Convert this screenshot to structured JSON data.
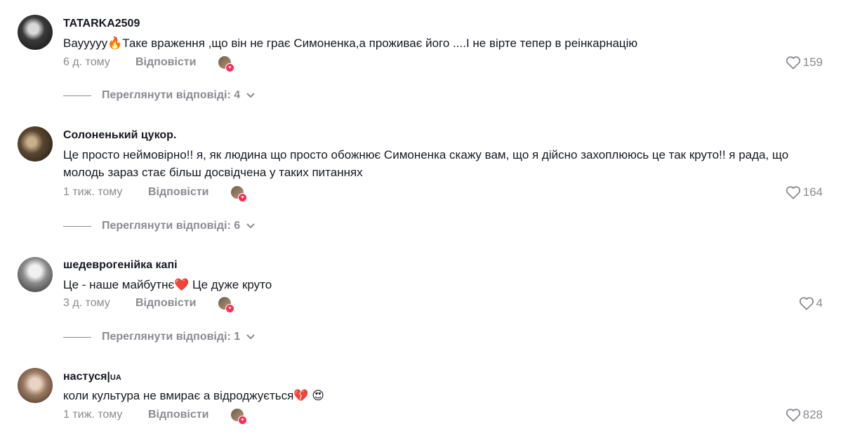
{
  "comments": [
    {
      "username": "TATARKA2509",
      "username_tag": "",
      "text": "Вауууyy🔥Таке враження ,що він не грає Симоненка,а проживає його ....І не вірте тепер в реінкарнацію",
      "time": "6 д. тому",
      "reply_label": "Відповісти",
      "likes": "159",
      "view_replies": "Переглянути відповіді: 4"
    },
    {
      "username": "Солоненький цукор.",
      "username_tag": "",
      "text": "Це просто неймовірно!! я, як людина що просто обожнює Симоненка скажу вам, що я дійсно захоплююсь це так круто!! я рада, що молодь зараз стає більш досвідчена у таких питаннях",
      "time": "1 тиж. тому",
      "reply_label": "Відповісти",
      "likes": "164",
      "view_replies": "Переглянути відповіді: 6"
    },
    {
      "username": "шедеврогенійка капі",
      "username_tag": "",
      "text": "Це - наше майбутнє❤️ Це дуже круто",
      "time": "3 д. тому",
      "reply_label": "Відповісти",
      "likes": "4",
      "view_replies": "Переглянути відповіді: 1"
    },
    {
      "username": "настуся|",
      "username_tag": "UA",
      "text": "коли культура не вмирає а відроджується💔 😍",
      "time": "1 тиж. тому",
      "reply_label": "Відповісти",
      "likes": "828",
      "view_replies": ""
    }
  ],
  "icons": {
    "like": "heart-outline-icon",
    "expand": "chevron-down-icon",
    "creator_liked": "creator-liked-badge-icon"
  },
  "colors": {
    "text": "#161823",
    "muted": "#8a8b91",
    "accent": "#fe2c55"
  }
}
